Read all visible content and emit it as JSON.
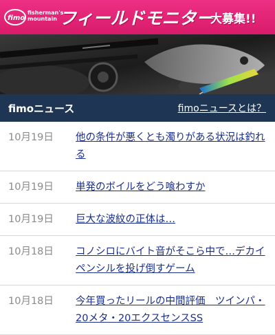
{
  "banner": {
    "brand_name_line1": "fisherman's",
    "brand_name_line2": "mountain",
    "brand_logo_text": "fimo",
    "title": "フィールドモニター",
    "subtitle": "大募集!!"
  },
  "news": {
    "header_title": "fimoニュース",
    "header_link": "fimoニュースとは？",
    "items": [
      {
        "date": "10月19日",
        "title": "他の条件が悪くとも濁りがある状況は釣れる"
      },
      {
        "date": "10月19日",
        "title": "単発のボイルをどう喰わすか"
      },
      {
        "date": "10月19日",
        "title": "巨大な波紋の正体は…"
      },
      {
        "date": "10月18日",
        "title": "コノシロにバイト音がそこら中で…デカイペンシルを投げ倒すゲーム"
      },
      {
        "date": "10月18日",
        "title": "今年買ったリールの中間評価　ツインパ・20メタ・20エクスセンスSS"
      }
    ]
  },
  "colors": {
    "banner_pink": "#e3267a",
    "header_navy": "#1e3553",
    "link_blue": "#1a2f8c",
    "date_gray": "#8a8a8a"
  }
}
